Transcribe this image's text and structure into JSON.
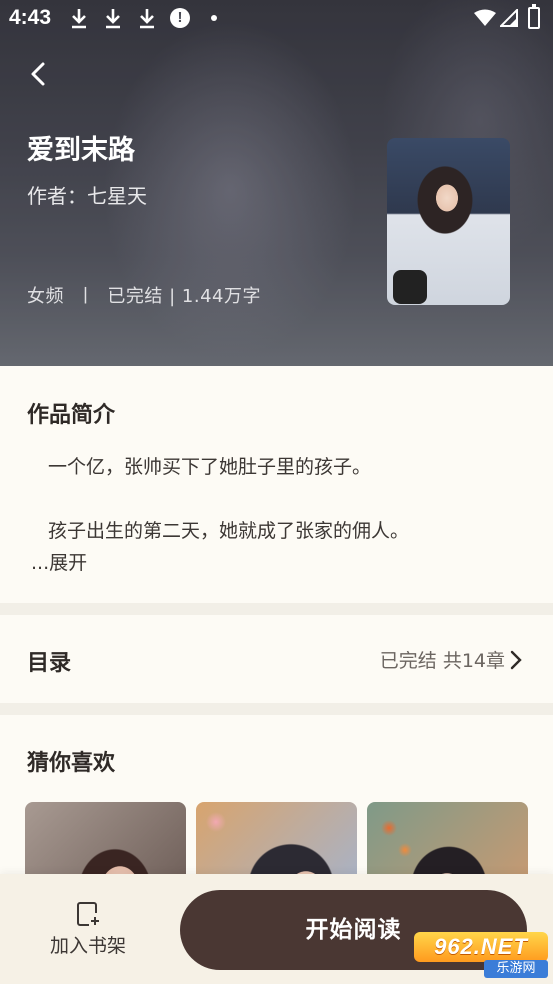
{
  "status_bar": {
    "time": "4:43",
    "alert_glyph": "!"
  },
  "book": {
    "title": "爱到末路",
    "author": "作者：七星天",
    "meta": "女频  丨  已完结 | 1.44万字"
  },
  "synopsis": {
    "title": "作品简介",
    "lines": [
      "一个亿，张帅买下了她肚子里的孩子。",
      "孩子出生的第二天，她就成了张家的佣人。"
    ],
    "expand": "...展开"
  },
  "catalog": {
    "label": "目录",
    "info": "已完结 共14章"
  },
  "recommend": {
    "title": "猜你喜欢",
    "item_count": 3
  },
  "bottom_bar": {
    "shelf_label": "加入书架",
    "read_label": "开始阅读"
  },
  "watermark": {
    "main": "962.NET",
    "sub": "乐游网"
  },
  "colors": {
    "read_button": "#4a3733",
    "page_bg": "#faf7f0"
  },
  "icons": [
    "back-arrow-icon",
    "download-icon",
    "alert-icon",
    "wifi-icon",
    "signal-icon",
    "battery-icon",
    "chevron-right-icon",
    "add-bookshelf-icon"
  ]
}
